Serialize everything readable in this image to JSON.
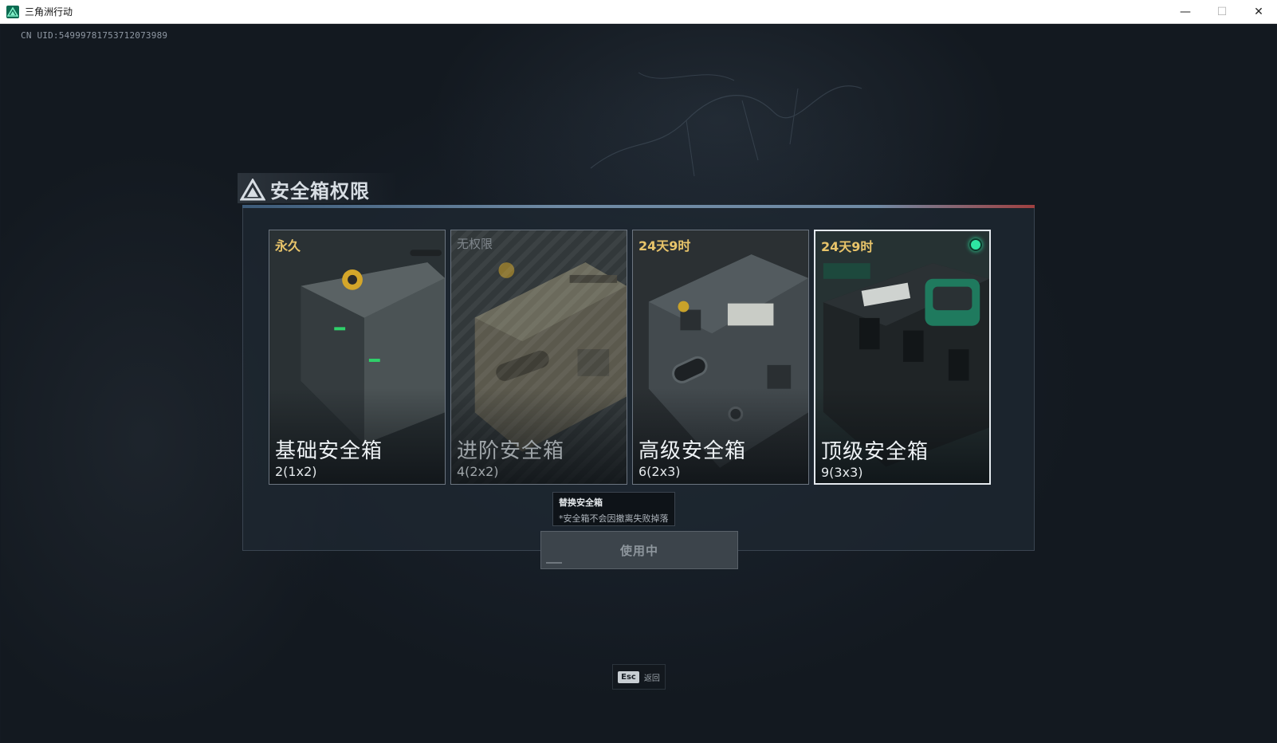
{
  "window": {
    "title": "三角洲行动",
    "minimize": "—",
    "maximize": "☐",
    "close": "✕"
  },
  "uid": "CN UID:549997817537120739​89",
  "panel": {
    "title": "安全箱权限"
  },
  "cards": [
    {
      "time": "永久",
      "name": "基础安全箱",
      "size": "2(1x2)"
    },
    {
      "time": "无权限",
      "name": "进阶安全箱",
      "size": "4(2x2)"
    },
    {
      "time": "24天9时",
      "name": "高级安全箱",
      "size": "6(2x3)"
    },
    {
      "time": "24天9时",
      "name": "顶级安全箱",
      "size": "9(3x3)"
    }
  ],
  "tooltip": {
    "title": "替换安全箱",
    "note": "*安全箱不会因撤离失败掉落"
  },
  "use_button": {
    "label": "使用中"
  },
  "esc": {
    "key": "Esc",
    "label": "返回"
  },
  "colors": {
    "accent_gold": "#e8c46a",
    "active_green": "#2ee5a2"
  }
}
